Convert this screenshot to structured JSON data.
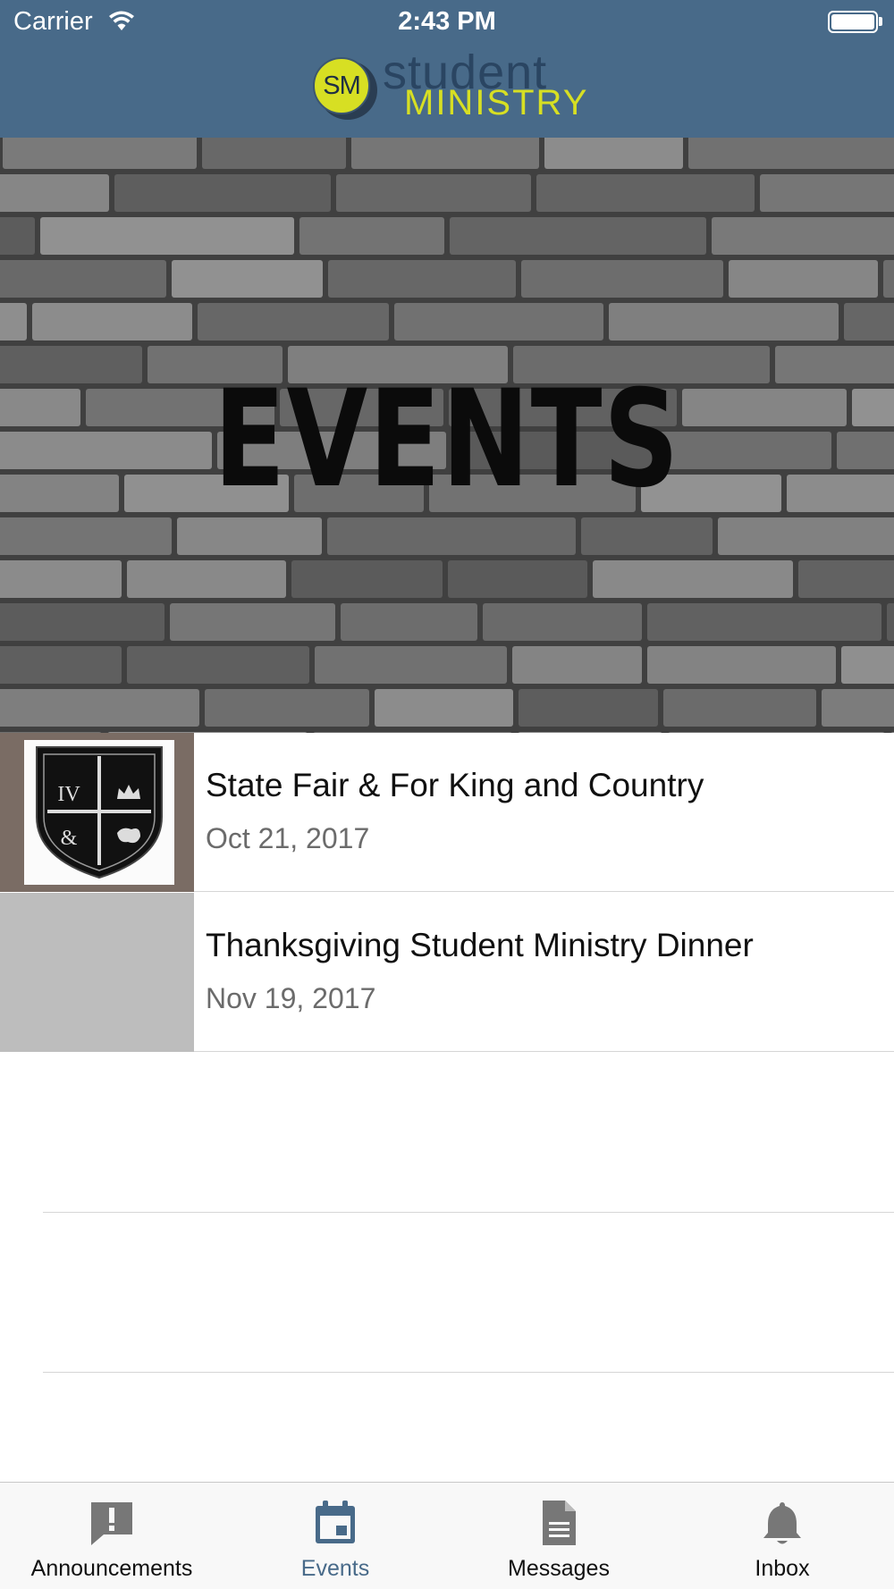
{
  "status_bar": {
    "carrier": "Carrier",
    "time": "2:43 PM"
  },
  "header": {
    "logo_initials": "SM",
    "logo_word_top": "student",
    "logo_word_bottom": "MINISTRY"
  },
  "hero": {
    "title": "EVENTS"
  },
  "events": [
    {
      "title": "State Fair & For King and Country",
      "date": "Oct 21, 2017",
      "has_image": true
    },
    {
      "title": "Thanksgiving Student Ministry Dinner",
      "date": "Nov 19, 2017",
      "has_image": false
    }
  ],
  "tabs": [
    {
      "label": "Announcements",
      "icon": "exclamation-bubble-icon",
      "active": false
    },
    {
      "label": "Events",
      "icon": "calendar-icon",
      "active": true
    },
    {
      "label": "Messages",
      "icon": "document-icon",
      "active": false
    },
    {
      "label": "Inbox",
      "icon": "bell-icon",
      "active": false
    }
  ],
  "colors": {
    "header_bg": "#486a89",
    "accent": "#486a89",
    "logo_yellow": "#d7df23"
  }
}
